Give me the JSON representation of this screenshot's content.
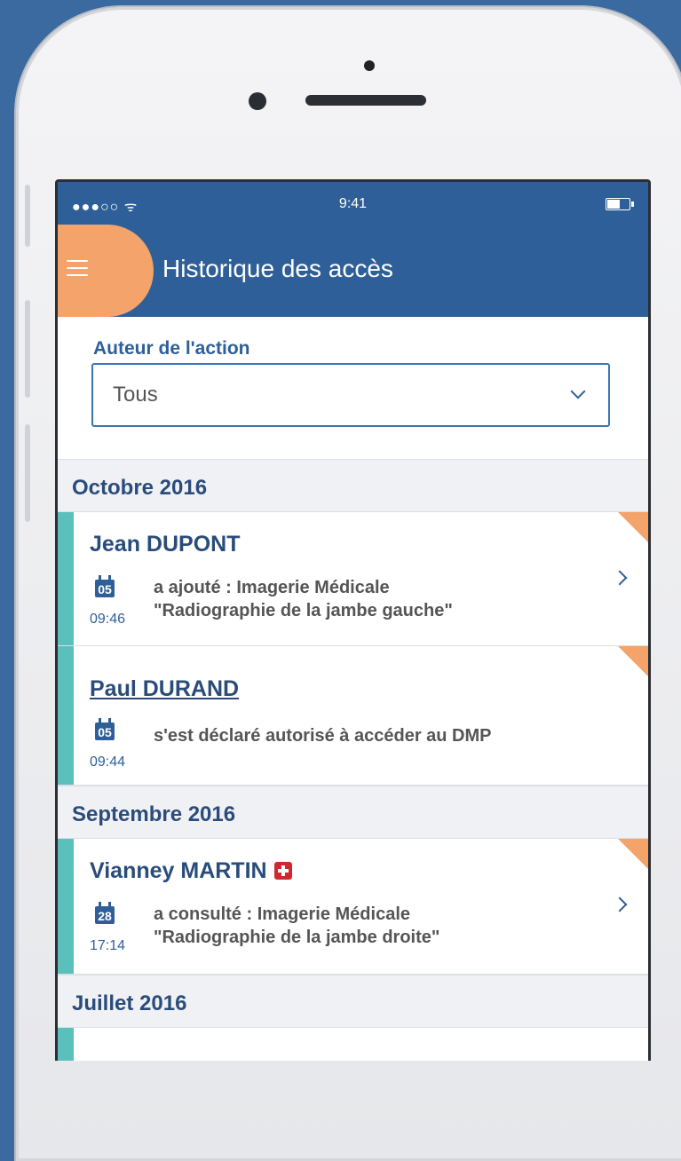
{
  "status": {
    "signal": "●●●○○ ᯤ",
    "time": "9:41"
  },
  "header": {
    "title": "Historique des accès",
    "menu_icon": "hamburger-icon"
  },
  "filter": {
    "label": "Auteur de l'action",
    "value": "Tous"
  },
  "groups": [
    {
      "month": "Octobre 2016",
      "entries": [
        {
          "name": "Jean DUPONT",
          "day": "05",
          "time": "09:46",
          "line1": "a ajouté : Imagerie Médicale",
          "line2": "\"Radiographie de la jambe gauche\""
        },
        {
          "name": "Paul DURAND",
          "day": "05",
          "time": "09:44",
          "line1": "s'est déclaré autorisé à accéder au DMP"
        }
      ]
    },
    {
      "month": "Septembre 2016",
      "entries": [
        {
          "name": "Vianney MARTIN",
          "day": "28",
          "time": "17:14",
          "line1": "a consulté : Imagerie Médicale",
          "line2": "\"Radiographie de la jambe droite\""
        }
      ]
    },
    {
      "month": "Juillet 2016",
      "entries": []
    }
  ],
  "colors": {
    "primary": "#2f5f98",
    "accent": "#f4a36a",
    "teal": "#5bc0bb",
    "medical_red": "#d0282e"
  }
}
